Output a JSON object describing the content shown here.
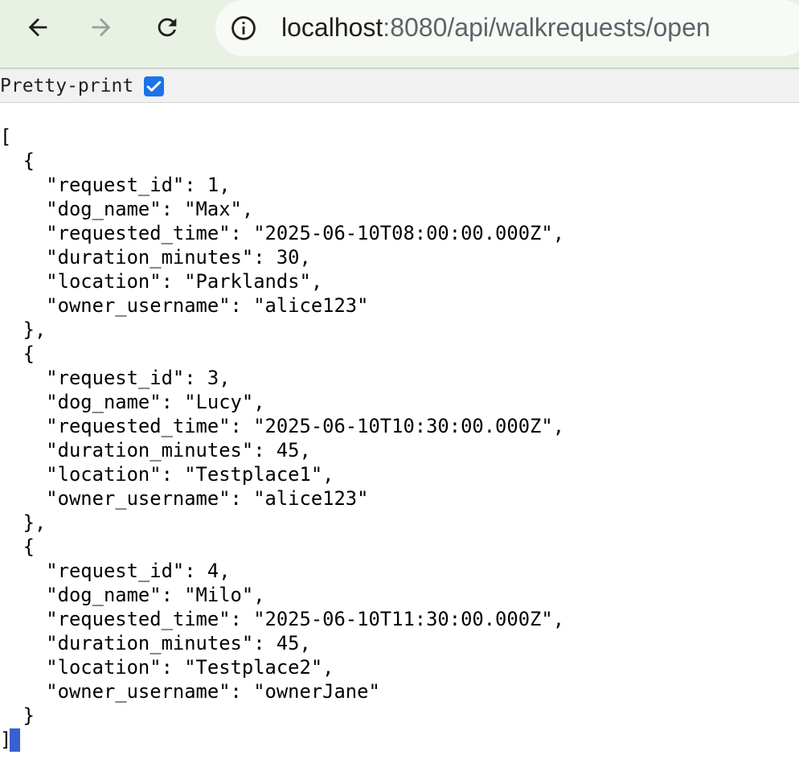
{
  "browser": {
    "url_host": "localhost",
    "url_rest": ":8080/api/walkrequests/open"
  },
  "viewer": {
    "pretty_print_label": "Pretty-print",
    "pretty_print_checked": true
  },
  "json_text": "[\n  {\n    \"request_id\": 1,\n    \"dog_name\": \"Max\",\n    \"requested_time\": \"2025-06-10T08:00:00.000Z\",\n    \"duration_minutes\": 30,\n    \"location\": \"Parklands\",\n    \"owner_username\": \"alice123\"\n  },\n  {\n    \"request_id\": 3,\n    \"dog_name\": \"Lucy\",\n    \"requested_time\": \"2025-06-10T10:30:00.000Z\",\n    \"duration_minutes\": 45,\n    \"location\": \"Testplace1\",\n    \"owner_username\": \"alice123\"\n  },\n  {\n    \"request_id\": 4,\n    \"dog_name\": \"Milo\",\n    \"requested_time\": \"2025-06-10T11:30:00.000Z\",\n    \"duration_minutes\": 45,\n    \"location\": \"Testplace2\",\n    \"owner_username\": \"ownerJane\"\n  }\n]",
  "icons": {
    "back": "arrow-left-icon",
    "forward": "arrow-right-icon",
    "reload": "reload-icon",
    "site_info": "info-circle-icon",
    "checkbox": "checkmark-icon"
  }
}
